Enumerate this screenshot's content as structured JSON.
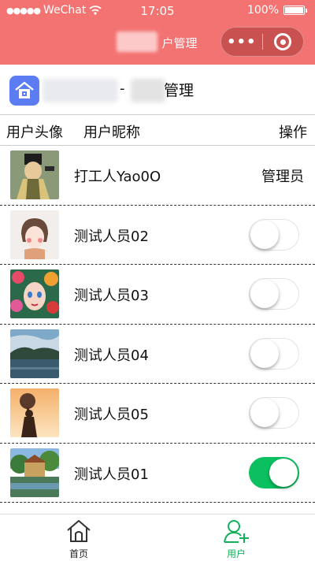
{
  "status": {
    "signal": "●●●●●",
    "carrier": "WeChat",
    "time": "17:05",
    "battery": "100%"
  },
  "nav": {
    "title": "户管理"
  },
  "org": {
    "dash": "-",
    "label": "管理"
  },
  "table": {
    "col_avatar": "用户头像",
    "col_nickname": "用户昵称",
    "col_action": "操作"
  },
  "users": [
    {
      "name": "打工人Yao0O",
      "role": "管理员"
    },
    {
      "name": "测试人员02",
      "enabled": false
    },
    {
      "name": "测试人员03",
      "enabled": false
    },
    {
      "name": "测试人员04",
      "enabled": false
    },
    {
      "name": "测试人员05",
      "enabled": false
    },
    {
      "name": "测试人员01",
      "enabled": true
    }
  ],
  "tabbar": {
    "home": "首页",
    "user": "用户"
  },
  "colors": {
    "header": "#f37372",
    "accent_green": "#0ac05f",
    "tab_active": "#13b05b",
    "org_icon": "#5b7cf2"
  }
}
